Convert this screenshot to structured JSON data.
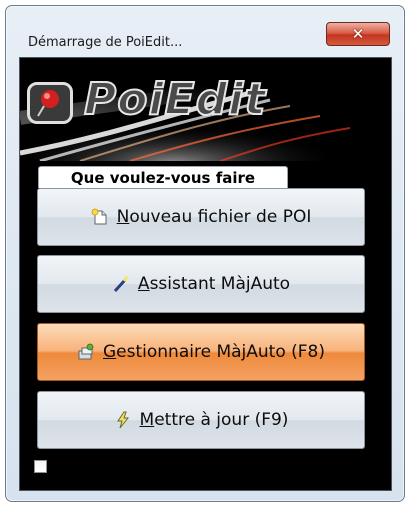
{
  "window": {
    "title": "Démarrage de PoiEdit...",
    "close_glyph": "✕"
  },
  "banner": {
    "app_name": "PoiEdit",
    "logo_icon": "red-pushpin-icon"
  },
  "panel": {
    "heading": "Que voulez-vous faire"
  },
  "actions": [
    {
      "mnemonic": "N",
      "rest": "ouveau fichier de POI",
      "icon": "new-file-icon",
      "active": false
    },
    {
      "mnemonic": "A",
      "rest": "ssistant MàjAuto",
      "icon": "magic-wand-icon",
      "active": false
    },
    {
      "mnemonic": "G",
      "rest": "estionnaire MàjAuto (F8)",
      "icon": "manager-icon",
      "active": true
    },
    {
      "mnemonic": "M",
      "rest": "ettre à jour (F9)",
      "icon": "update-bolt-icon",
      "active": false
    }
  ],
  "checkbox": {
    "checked": false
  },
  "colors": {
    "active_button": "#f4a162",
    "close_button": "#c2361f",
    "background": "#000000"
  }
}
